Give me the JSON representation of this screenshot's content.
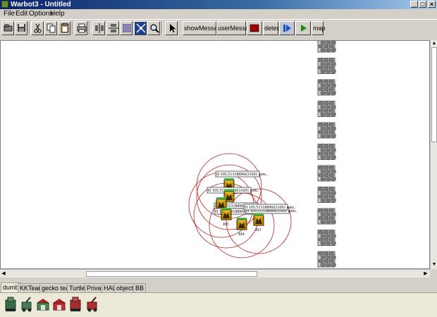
{
  "window": {
    "title": "Warbot3 - Untitled",
    "minimize_glyph": "_",
    "maximize_glyph": "□",
    "close_glyph": "×"
  },
  "menu": {
    "items": [
      "File",
      "Edit",
      "Options",
      "Help"
    ]
  },
  "toolbar": {
    "show_messages_label": "showMessages",
    "user_message_label": "userMessage",
    "detect_label": "detect",
    "map_label": "map",
    "stop_color": "#a00000",
    "step_color": "#1f4fbf",
    "play_color": "#1a8a1a"
  },
  "canvas": {
    "agents": [
      {
        "name": "",
        "label": "D 105.51318896631691 som.."
      },
      {
        "name": "J02",
        "label": "D 105.51318896631691 som.."
      },
      {
        "name": "J06",
        "label": "D 105.51318896631691 som.."
      },
      {
        "name": "J05",
        "label": "D 105.51318896631691 som.."
      },
      {
        "name": "J04",
        "label": "D 105.51318896631691 som.."
      },
      {
        "name": "J03",
        "label": "D 105.51318896631691 som.."
      }
    ],
    "wall_color": "#7a7a7a",
    "radius_color": "#b22222"
  },
  "tabs": {
    "items": [
      "dumb",
      "KKTeam",
      "gecko team",
      "Turtle",
      "Privat",
      "HAL",
      "objects",
      "BB"
    ],
    "active": "dumb"
  },
  "palette": {
    "items": [
      "rocket-launcher-icon",
      "explorer-icon",
      "base-icon",
      "home-icon",
      "rocket-launcher-red-icon",
      "explorer-red-icon"
    ]
  },
  "scroll": {
    "up_arrow": "▲",
    "down_arrow": "▼",
    "left_arrow": "◀",
    "right_arrow": "▶"
  }
}
